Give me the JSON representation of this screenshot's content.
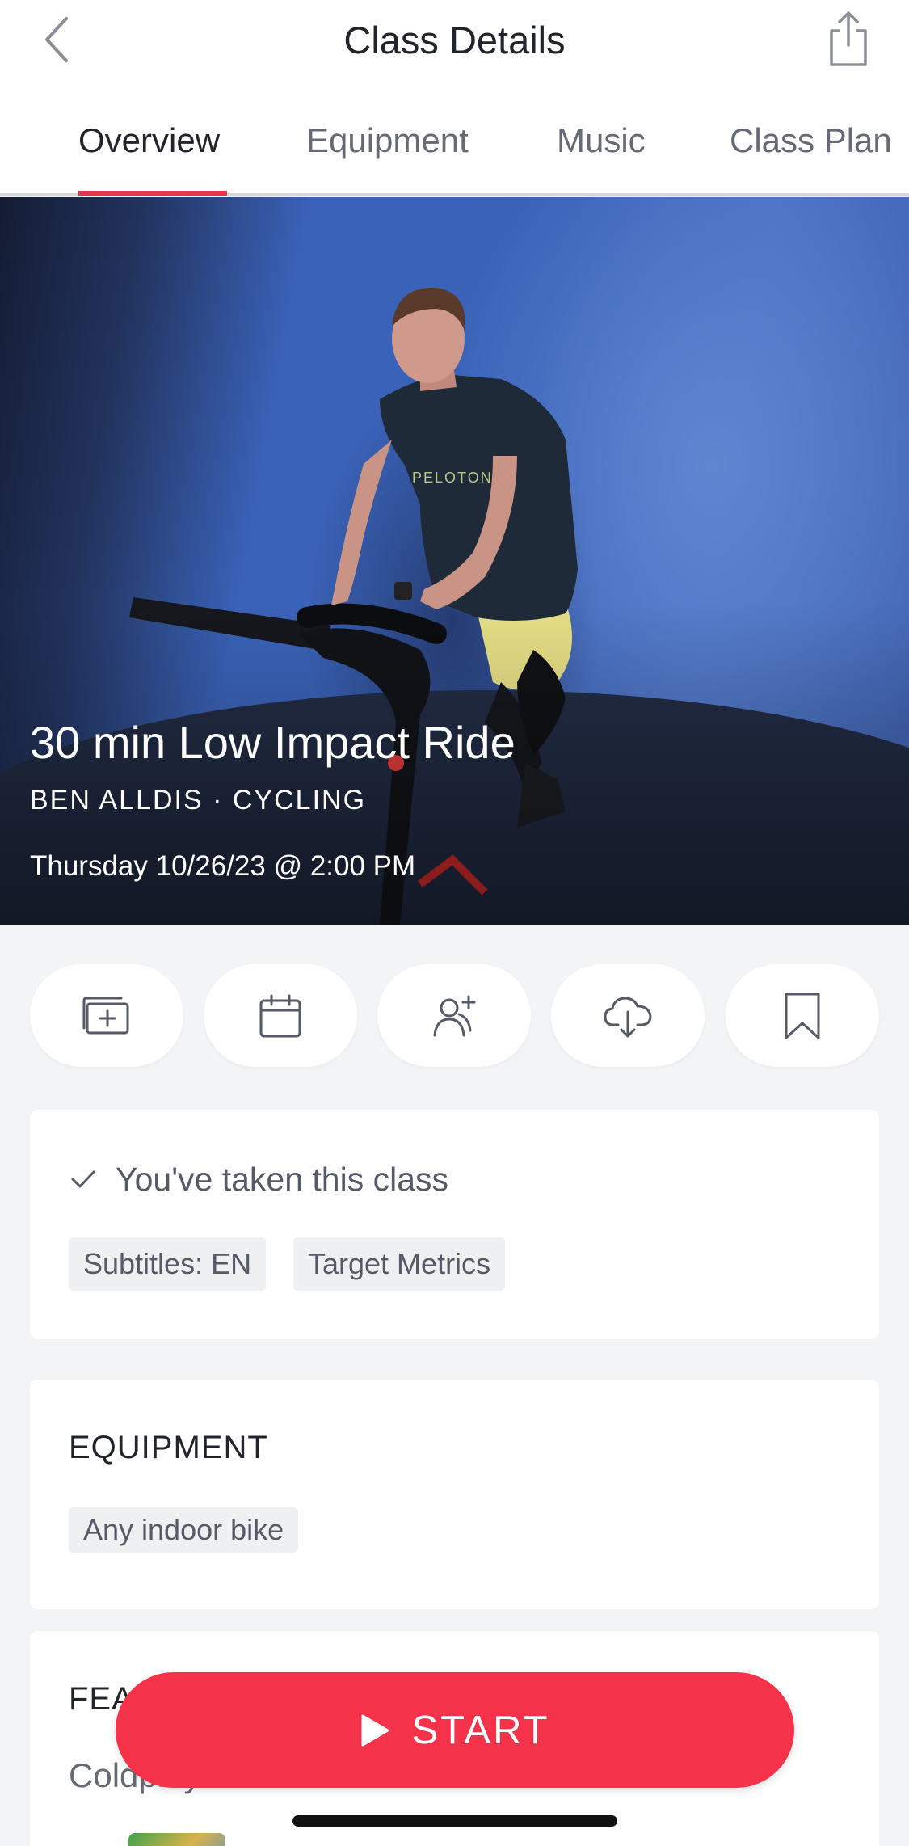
{
  "header": {
    "title": "Class Details",
    "back_icon": "chevron-left-icon",
    "share_icon": "share-icon"
  },
  "tabs": [
    {
      "label": "Overview",
      "active": true
    },
    {
      "label": "Equipment",
      "active": false
    },
    {
      "label": "Music",
      "active": false
    },
    {
      "label": "Class Plan",
      "active": false
    }
  ],
  "hero": {
    "class_title": "30 min Low Impact Ride",
    "instructor_line": "BEN ALLDIS · CYCLING",
    "date": "Thursday 10/26/23 @ 2:00 PM"
  },
  "actions": [
    {
      "name": "add-to-stack-button",
      "icon": "add-to-stack-icon"
    },
    {
      "name": "schedule-button",
      "icon": "calendar-icon"
    },
    {
      "name": "invite-friends-button",
      "icon": "add-user-icon"
    },
    {
      "name": "download-button",
      "icon": "cloud-download-icon"
    },
    {
      "name": "bookmark-button",
      "icon": "bookmark-icon"
    }
  ],
  "status": {
    "taken_text": "You've taken this class",
    "tags": [
      "Subtitles: EN",
      "Target Metrics"
    ]
  },
  "equipment": {
    "heading": "EQUIPMENT",
    "items": [
      "Any indoor bike"
    ]
  },
  "featured": {
    "heading": "FEA",
    "artists": "Coldplay · The Weeknd"
  },
  "cta": {
    "start_label": "START"
  },
  "colors": {
    "accent": "#f4334b",
    "tab_underline": "#e8334f",
    "background": "#f3f4f6"
  }
}
